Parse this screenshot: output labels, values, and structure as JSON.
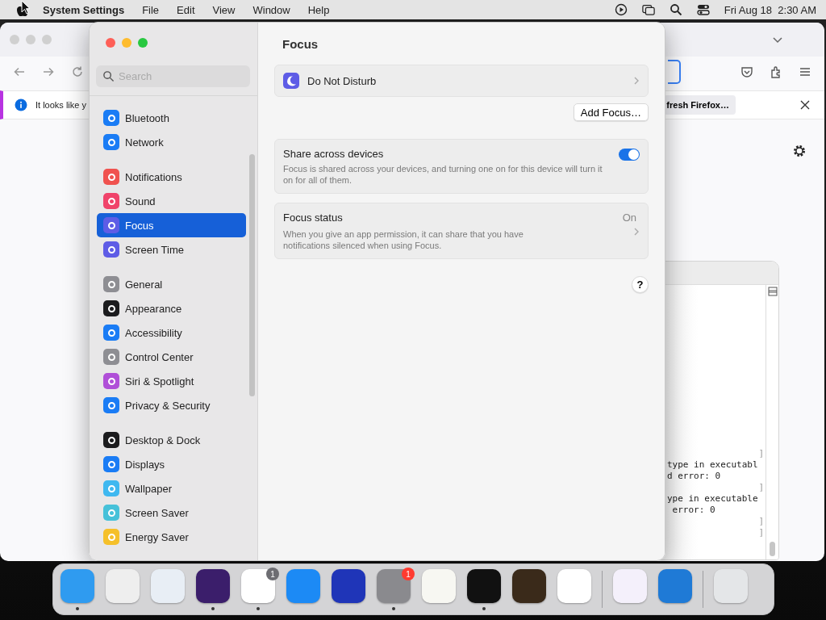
{
  "menu_bar": {
    "app_name": "System Settings",
    "menus": [
      "File",
      "Edit",
      "View",
      "Window",
      "Help"
    ],
    "clock": "Fri Aug 18  2:30 AM"
  },
  "browser": {
    "notification": {
      "message": "It looks like y",
      "button": "fresh Firefox…"
    }
  },
  "terminal": {
    "lines": [
      {
        "kind": "mark",
        "text": "]"
      },
      {
        "kind": "output",
        "text": "type in executabl"
      },
      {
        "kind": "output",
        "text": "d error: 0"
      },
      {
        "kind": "mark",
        "text": "]"
      },
      {
        "kind": "output",
        "text": "ype in executable"
      },
      {
        "kind": "output",
        "text": " error: 0"
      },
      {
        "kind": "mark",
        "text": "]"
      },
      {
        "kind": "mark",
        "text": "]"
      }
    ]
  },
  "settings": {
    "search": {
      "placeholder": "Search"
    },
    "sidebar": {
      "groups": [
        [
          {
            "label": "Bluetooth",
            "color": "#1a7cf5",
            "selected": false
          },
          {
            "label": "Network",
            "color": "#1a7cf5",
            "selected": false
          }
        ],
        [
          {
            "label": "Notifications",
            "color": "#f0524f",
            "selected": false
          },
          {
            "label": "Sound",
            "color": "#f0436a",
            "selected": false
          },
          {
            "label": "Focus",
            "color": "#5e5ce6",
            "selected": true
          },
          {
            "label": "Screen Time",
            "color": "#5e5ce6",
            "selected": false
          }
        ],
        [
          {
            "label": "General",
            "color": "#8e8e93",
            "selected": false
          },
          {
            "label": "Appearance",
            "color": "#1c1c1e",
            "selected": false
          },
          {
            "label": "Accessibility",
            "color": "#1a7cf5",
            "selected": false
          },
          {
            "label": "Control Center",
            "color": "#8e8e93",
            "selected": false
          },
          {
            "label": "Siri & Spotlight",
            "color": "#b04fd8",
            "selected": false
          },
          {
            "label": "Privacy & Security",
            "color": "#1a7cf5",
            "selected": false
          }
        ],
        [
          {
            "label": "Desktop & Dock",
            "color": "#1c1c1e",
            "selected": false
          },
          {
            "label": "Displays",
            "color": "#1a7cf5",
            "selected": false
          },
          {
            "label": "Wallpaper",
            "color": "#3fb8f0",
            "selected": false
          },
          {
            "label": "Screen Saver",
            "color": "#46c1d9",
            "selected": false
          },
          {
            "label": "Energy Saver",
            "color": "#f5c02a",
            "selected": false
          }
        ]
      ]
    },
    "title": "Focus",
    "focus_modes": [
      {
        "label": "Do Not Disturb"
      }
    ],
    "add_button": "Add Focus…",
    "share": {
      "title": "Share across devices",
      "description": "Focus is shared across your devices, and turning one on for this device will turn it on for all of them.",
      "on": true
    },
    "status": {
      "title": "Focus status",
      "value": "On",
      "description": "When you give an app permission, it can share that you have notifications silenced when using Focus."
    },
    "help": "?"
  },
  "dock": {
    "sections": [
      {
        "apps": [
          {
            "color": "#2f9bf0",
            "running": true
          },
          {
            "color": "#eeeeee",
            "running": false
          },
          {
            "color": "#e8eef5",
            "running": false
          },
          {
            "color": "#3b1e6b",
            "running": true
          },
          {
            "color": "#ffffff",
            "running": true,
            "badge": {
              "text": "1",
              "color": "#6d6d72"
            }
          },
          {
            "color": "#1c8af5",
            "running": false
          },
          {
            "color": "#1f35b8",
            "running": false
          },
          {
            "color": "#8a8a8e",
            "running": true,
            "badge": {
              "text": "1",
              "color": "#ff3b30"
            }
          },
          {
            "color": "#f7f7f2",
            "running": false
          },
          {
            "color": "#111111",
            "running": true
          },
          {
            "color": "#3a2a1a",
            "running": false
          },
          {
            "color": "#ffffff",
            "running": false
          }
        ]
      },
      {
        "apps": [
          {
            "color": "#f4f0fb",
            "running": false
          },
          {
            "color": "#1f7ad6",
            "running": false
          }
        ]
      },
      {
        "apps": [
          {
            "color": "#e4e6e8",
            "running": false
          }
        ]
      }
    ]
  }
}
